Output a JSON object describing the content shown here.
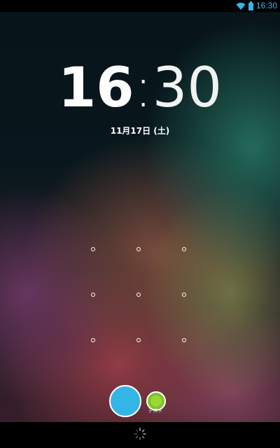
{
  "status_bar": {
    "time": "16:30",
    "icons": [
      "wifi-icon",
      "battery-icon"
    ],
    "accent_color": "#33b5e5"
  },
  "lockscreen": {
    "clock": {
      "hours": "16",
      "separator": ":",
      "minutes": "30"
    },
    "date": "11月17日 (土)",
    "pattern": {
      "rows": 3,
      "columns": 3,
      "dot_count": 9
    },
    "unlock_targets": [
      {
        "name": "blue-unlock-target",
        "color": "#33b5e5"
      },
      {
        "name": "green-app-target",
        "color": "#7fc32a",
        "label": "テスト"
      }
    ]
  },
  "nav_bar": {
    "icons": [
      "loading-spinner-icon"
    ]
  }
}
